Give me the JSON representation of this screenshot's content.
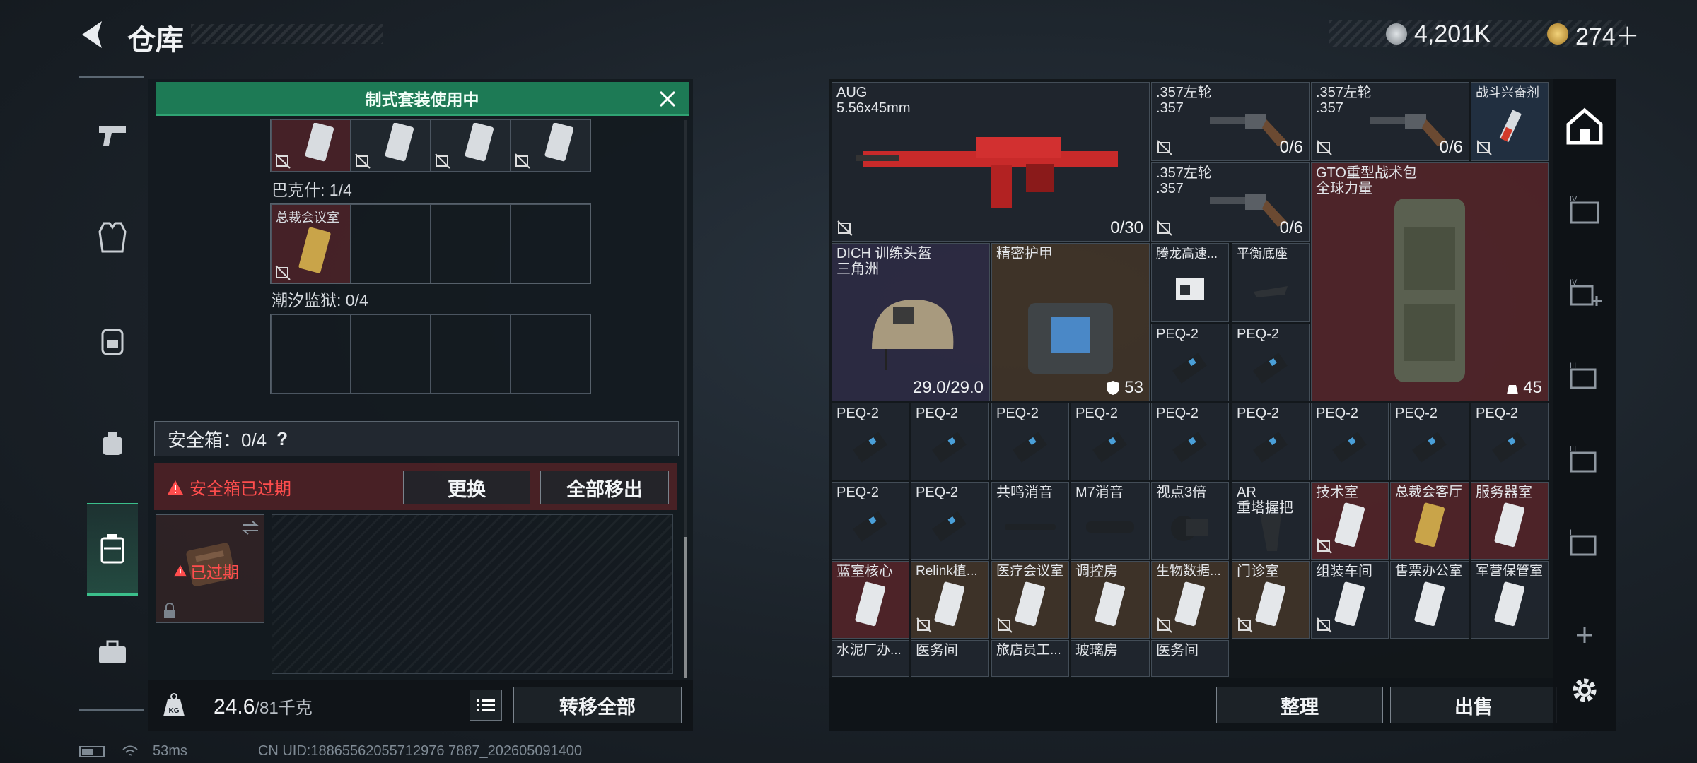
{
  "header": {
    "title": "仓库",
    "currency1": "4,201K",
    "currency2": "274＋"
  },
  "left_panel": {
    "banner": "制式套装使用中",
    "section_bakshi": "巴克什: 1/4",
    "bakshi_card_label": "总裁会议室",
    "section_tide": "潮汐监狱: 0/4",
    "safe_box_label": "安全箱：0/4",
    "safe_box_help": "?",
    "expired_notice": "安全箱已过期",
    "replace_button": "更换",
    "remove_all_button": "全部移出",
    "expired_badge": "已过期",
    "weight_value": "24.6",
    "weight_max": "/81千克",
    "weight_unit_icon": "KG",
    "transfer_all_button": "转移全部"
  },
  "right_panel": {
    "items": [
      {
        "name": "AUG\n5.56x45mm",
        "count": "0/30"
      },
      {
        "name": ".357左轮\n.357",
        "count": "0/6"
      },
      {
        "name": ".357左轮\n.357",
        "count": "0/6"
      },
      {
        "name": "战斗兴奋剂",
        "count": ""
      },
      {
        "name": ".357左轮\n.357",
        "count": "0/6"
      },
      {
        "name": "GTO重型战术包\n全球力量",
        "count": "45"
      },
      {
        "name": "DICH 训练头盔\n三角洲",
        "count": "29.0/29.0"
      },
      {
        "name": "精密护甲",
        "count": "53"
      },
      {
        "name": "腾龙高速...",
        "count": ""
      },
      {
        "name": "平衡底座",
        "count": ""
      },
      {
        "name": "PEQ-2",
        "count": ""
      },
      {
        "name": "共鸣消音",
        "count": ""
      },
      {
        "name": "M7消音",
        "count": ""
      },
      {
        "name": "视点3倍",
        "count": ""
      },
      {
        "name": "AR\n重塔握把",
        "count": ""
      },
      {
        "name": "技术室",
        "count": ""
      },
      {
        "name": "总裁会客厅",
        "count": ""
      },
      {
        "name": "服务器室",
        "count": ""
      },
      {
        "name": "蓝室核心",
        "count": ""
      },
      {
        "name": "Relink植...",
        "count": ""
      },
      {
        "name": "医疗会议室",
        "count": ""
      },
      {
        "name": "调控房",
        "count": ""
      },
      {
        "name": "生物数据...",
        "count": ""
      },
      {
        "name": "门诊室",
        "count": ""
      },
      {
        "name": "组装车间",
        "count": ""
      },
      {
        "name": "售票办公室",
        "count": ""
      },
      {
        "name": "军营保管室",
        "count": ""
      },
      {
        "name": "水泥厂办...",
        "count": ""
      },
      {
        "name": "医务间",
        "count": ""
      },
      {
        "name": "旅店员工...",
        "count": ""
      },
      {
        "name": "玻璃房",
        "count": ""
      }
    ],
    "organize_button": "整理",
    "sell_button": "出售"
  },
  "status": {
    "ping": "53ms",
    "uid": "CN UID:18865562055712976 7887_202605091400"
  },
  "colors": {
    "green": "#1d7a55",
    "red_alert": "#ff4d4d",
    "active": "#3bbf8b"
  }
}
